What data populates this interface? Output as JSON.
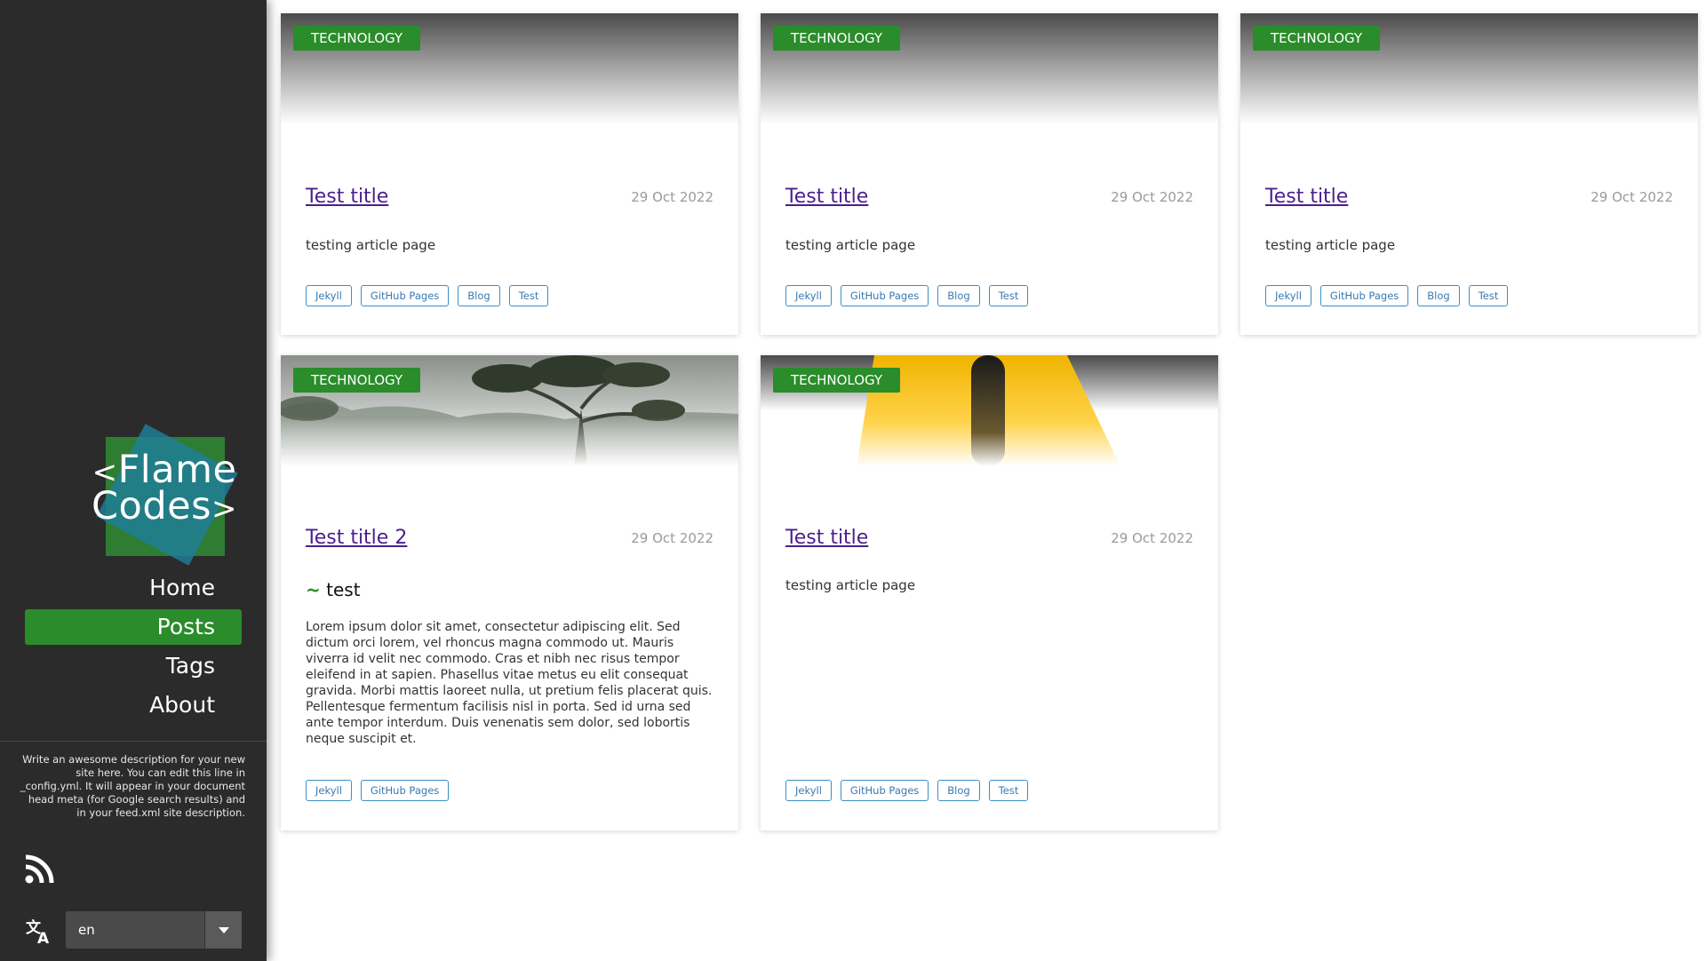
{
  "sidebar": {
    "logo": {
      "line1": "Flame",
      "line2": "Codes",
      "open": "<",
      "close": ">"
    },
    "nav": [
      {
        "label": "Home",
        "active": false
      },
      {
        "label": "Posts",
        "active": true
      },
      {
        "label": "Tags",
        "active": false
      },
      {
        "label": "About",
        "active": false
      }
    ],
    "description": "Write an awesome description for your new site here. You can edit this line in _config.yml. It will appear in your document head meta (for Google search results) and in your feed.xml site description.",
    "rss_icon": "rss-icon",
    "language_icon": "translate-icon",
    "language": {
      "value": "en"
    }
  },
  "posts": [
    {
      "category": "TECHNOLOGY",
      "title": "Test title",
      "date": "29 Oct 2022",
      "excerpt": "testing article page",
      "tags": [
        "Jekyll",
        "GitHub Pages",
        "Blog",
        "Test"
      ],
      "image": "gradient"
    },
    {
      "category": "TECHNOLOGY",
      "title": "Test title",
      "date": "29 Oct 2022",
      "excerpt": "testing article page",
      "tags": [
        "Jekyll",
        "GitHub Pages",
        "Blog",
        "Test"
      ],
      "image": "gradient"
    },
    {
      "category": "TECHNOLOGY",
      "title": "Test title",
      "date": "29 Oct 2022",
      "excerpt": "testing article page",
      "tags": [
        "Jekyll",
        "GitHub Pages",
        "Blog",
        "Test"
      ],
      "image": "gradient"
    },
    {
      "category": "TECHNOLOGY",
      "title": "Test title 2",
      "date": "29 Oct 2022",
      "subheading": "test",
      "excerpt": "Lorem ipsum dolor sit amet, consectetur adipiscing elit. Sed dictum orci lorem, vel rhoncus magna commodo ut. Mauris viverra id velit nec commodo. Cras et nibh nec risus tempor eleifend in at sapien. Phasellus vitae metus eu elit consequat gravida. Morbi mattis laoreet nulla, ut pretium felis placerat quis. Pellentesque fermentum facilisis nisl in porta. Sed id urna sed ante tempor interdum. Duis venenatis sem dolor, sed lobortis neque suscipit et.",
      "tags": [
        "Jekyll",
        "GitHub Pages"
      ],
      "image": "forest"
    },
    {
      "category": "TECHNOLOGY",
      "title": "Test title",
      "date": "29 Oct 2022",
      "excerpt": "testing article page",
      "tags": [
        "Jekyll",
        "GitHub Pages",
        "Blog",
        "Test"
      ],
      "image": "road"
    }
  ],
  "colors": {
    "accent": "#2a8c2a",
    "sidebar": "#2b2b2b",
    "link": "#4b1f8c",
    "tag": "#3a8ec8"
  }
}
